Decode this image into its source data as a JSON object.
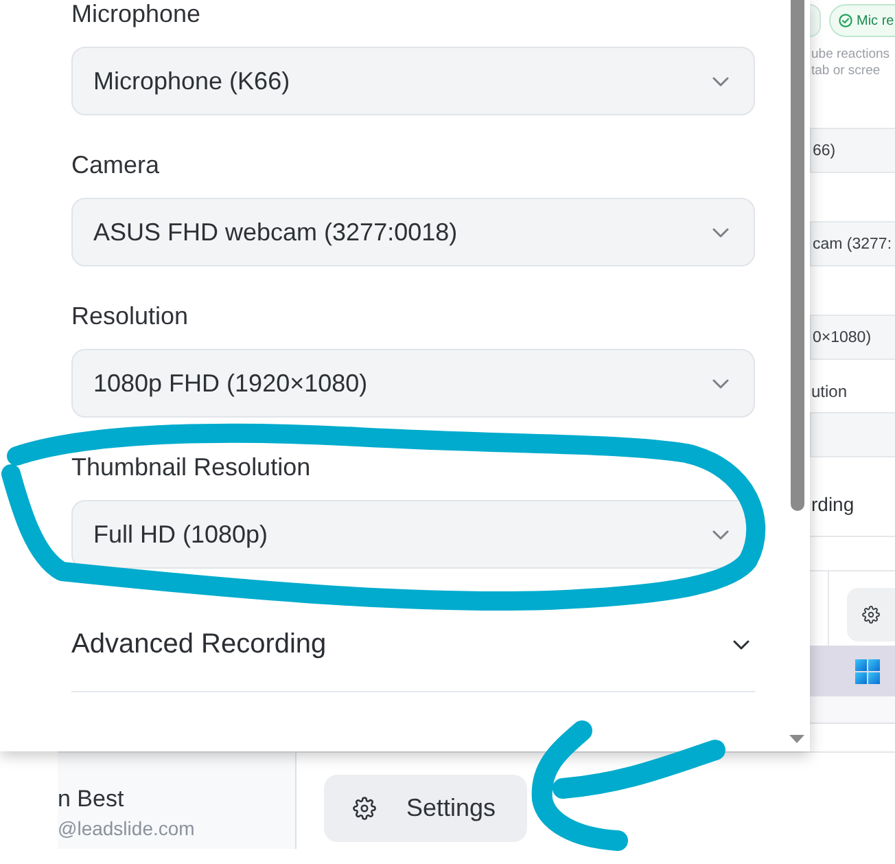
{
  "settings_panel": {
    "fields": [
      {
        "label": "Microphone",
        "value": "Microphone (K66)"
      },
      {
        "label": "Camera",
        "value": "ASUS FHD webcam (3277:0018)"
      },
      {
        "label": "Resolution",
        "value": "1080p FHD (1920×1080)"
      },
      {
        "label": "Thumbnail Resolution",
        "value": "Full HD (1080p)"
      }
    ],
    "sections": [
      {
        "title": "Advanced Recording",
        "expanded": false
      }
    ]
  },
  "background_app": {
    "status_chip": {
      "label": "Mic re"
    },
    "description": [
      "ube reactions",
      "tab or scree"
    ],
    "form_rows": [
      {
        "kind": "select",
        "text": "66)"
      },
      {
        "kind": "select",
        "text": "cam (3277:"
      },
      {
        "kind": "select",
        "text": "0×1080)"
      },
      {
        "kind": "label",
        "text": "ution"
      },
      {
        "kind": "select"
      },
      {
        "kind": "heading",
        "text": "rding"
      }
    ],
    "user": {
      "name": "n Best",
      "email": "@leadslide.com"
    },
    "settings_button": {
      "label": "Settings"
    }
  }
}
